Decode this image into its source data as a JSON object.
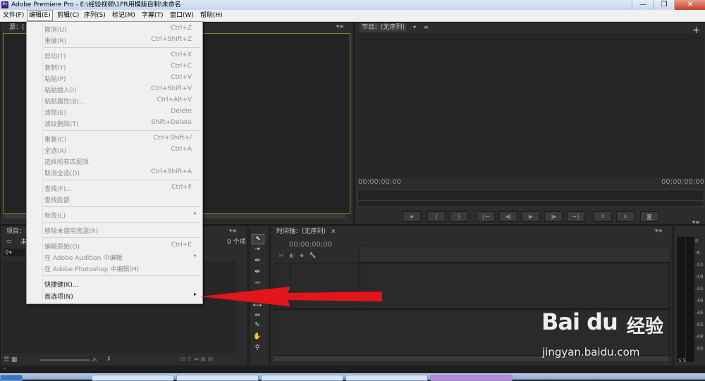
{
  "window": {
    "title": "Adobe Premiere Pro - E:\\经验视频\\1PR用模版自制\\未命名",
    "app_icon": "Pr",
    "controls": [
      "—",
      "❐",
      "✕"
    ]
  },
  "menubar": {
    "items": [
      "文件(F)",
      "编辑(E)",
      "剪辑(C)",
      "序列(S)",
      "标记(M)",
      "字幕(T)",
      "窗口(W)",
      "帮助(H)"
    ],
    "active": "编辑(E)"
  },
  "source_panel": {
    "tab": "源：("
  },
  "program_panel": {
    "tab": "节目：(无序列)",
    "timecode_left": "00;00;00;00",
    "timecode_right": "00;00;00;00",
    "buttons": [
      "marker-icon",
      "in-point-icon",
      "out-point-icon",
      "go-to-in-icon",
      "step-back-icon",
      "play-icon",
      "step-forward-icon",
      "go-to-out-icon",
      "lift-icon",
      "extract-icon",
      "export-frame-icon"
    ]
  },
  "project_panel": {
    "tab": "项目：未",
    "name_stub": "未",
    "count": "0 个项"
  },
  "timeline_panel": {
    "tab": "时间轴：(无序列)",
    "close": "×",
    "timecode": "00;00;00;00"
  },
  "tools": [
    "selection-tool-icon",
    "track-select-icon",
    "ripple-edit-icon",
    "rolling-edit-icon",
    "rate-stretch-icon",
    "razor-icon",
    "slip-icon",
    "slide-icon",
    "pen-icon",
    "hand-icon",
    "zoom-icon"
  ],
  "audio_meter": {
    "labels": [
      "0",
      "-6",
      "-12",
      "-18",
      "-24",
      "-30",
      "-36",
      "-42",
      "-48",
      "-54"
    ],
    "footer": "S S"
  },
  "edit_menu": {
    "groups": [
      [
        {
          "label": "撤消(U)",
          "shortcut": "Ctrl+Z",
          "enabled": false
        },
        {
          "label": "重做(R)",
          "shortcut": "Ctrl+Shift+Z",
          "enabled": false
        }
      ],
      [
        {
          "label": "剪切(T)",
          "shortcut": "Ctrl+X",
          "enabled": false
        },
        {
          "label": "复制(Y)",
          "shortcut": "Ctrl+C",
          "enabled": false
        },
        {
          "label": "粘贴(P)",
          "shortcut": "Ctrl+V",
          "enabled": false
        },
        {
          "label": "粘贴插入(I)",
          "shortcut": "Ctrl+Shift+V",
          "enabled": false
        },
        {
          "label": "粘贴属性(B)...",
          "shortcut": "Ctrl+Alt+V",
          "enabled": false
        },
        {
          "label": "清除(E)",
          "shortcut": "Delete",
          "enabled": false
        },
        {
          "label": "波纹删除(T)",
          "shortcut": "Shift+Delete",
          "enabled": false
        }
      ],
      [
        {
          "label": "重复(C)",
          "shortcut": "Ctrl+Shift+/",
          "enabled": false
        },
        {
          "label": "全选(A)",
          "shortcut": "Ctrl+A",
          "enabled": false
        },
        {
          "label": "选择所有匹配项",
          "shortcut": "",
          "enabled": false
        },
        {
          "label": "取消全选(D)",
          "shortcut": "Ctrl+Shift+A",
          "enabled": false
        }
      ],
      [
        {
          "label": "查找(F)...",
          "shortcut": "Ctrl+F",
          "enabled": false
        },
        {
          "label": "查找脸部",
          "shortcut": "",
          "enabled": false
        }
      ],
      [
        {
          "label": "标签(L)",
          "shortcut": "",
          "enabled": false,
          "submenu": true
        }
      ],
      [
        {
          "label": "移除未使用资源(R)",
          "shortcut": "",
          "enabled": false
        }
      ],
      [
        {
          "label": "编辑原始(O)",
          "shortcut": "Ctrl+E",
          "enabled": false
        },
        {
          "label": "在 Adobe Audition 中编辑",
          "shortcut": "",
          "enabled": false,
          "submenu": true
        },
        {
          "label": "在 Adobe Photoshop 中编辑(H)",
          "shortcut": "",
          "enabled": false
        }
      ],
      [
        {
          "label": "快捷键(K)...",
          "shortcut": "",
          "enabled": true
        },
        {
          "label": "首选项(N)",
          "shortcut": "",
          "enabled": true,
          "submenu": true
        }
      ]
    ]
  },
  "annotation": {
    "color": "#e3151b",
    "target": "首选项(N)"
  },
  "watermark": {
    "logo": "Bai du",
    "brand": "经验",
    "url": "jingyan.baidu.com"
  },
  "colors": {
    "panel_bg": "#2c2c2c",
    "menu_bg": "#f0f0f0",
    "accent": "#2a6fd1",
    "source_border": "#8b7a3a"
  }
}
